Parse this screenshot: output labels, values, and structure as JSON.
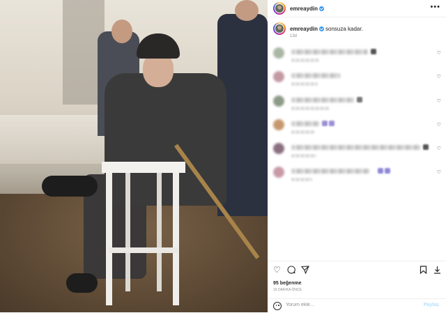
{
  "post": {
    "username": "emreaydin",
    "caption_user": "emreaydin",
    "caption_text": "sonsuza kadar.",
    "caption_time": "13d",
    "likes": "95 beğenme",
    "posted_time": "16 dakika önce"
  },
  "comment_input": {
    "placeholder": "Yorum ekle...",
    "share_label": "Paylaş"
  },
  "icons": {
    "more": "more-horizontal-icon",
    "heart": "heart-icon",
    "comment": "comment-icon",
    "share": "paper-plane-icon",
    "save": "bookmark-icon",
    "download": "download-icon",
    "emoji": "emoji-icon",
    "verified": "verified-badge-icon"
  },
  "colors": {
    "verified": "#3897f0",
    "secondary_text": "#8e8e8e",
    "primary_text": "#262626"
  },
  "comments_blurred": 6
}
